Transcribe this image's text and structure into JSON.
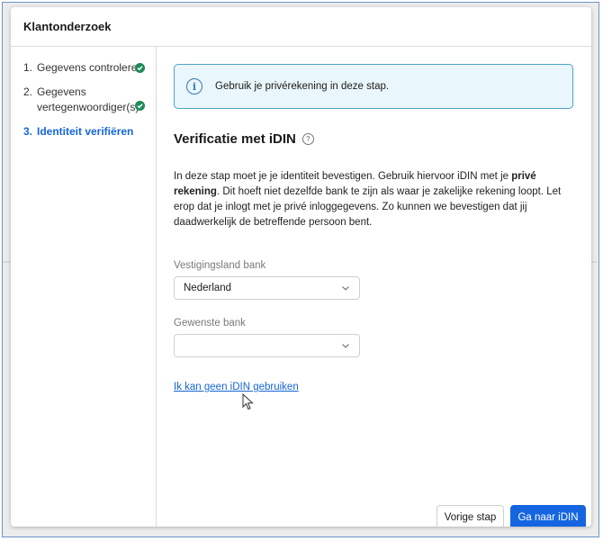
{
  "card": {
    "title": "Klantonderzoek"
  },
  "steps": [
    {
      "number": "1.",
      "label": "Gegevens controleren",
      "status": "completed"
    },
    {
      "number": "2.",
      "label": "Gegevens vertegenwoordiger(s)",
      "status": "completed"
    },
    {
      "number": "3.",
      "label": "Identiteit verifiëren",
      "status": "active"
    }
  ],
  "info_banner": {
    "icon": "info-icon",
    "text": "Gebruik je privérekening in deze stap."
  },
  "section": {
    "title": "Verificatie met iDIN",
    "help_icon": "question-circle-icon",
    "paragraph_before": "In deze stap moet je je identiteit bevestigen. Gebruik hiervoor iDIN met je ",
    "paragraph_bold": "privé rekening",
    "paragraph_after": ". Dit hoeft niet dezelfde bank te zijn als waar je zakelijke rekening loopt. Let erop dat je inlogt met je privé inloggegevens. Zo kunnen we bevestigen dat jij daadwerkelijk de betreffende persoon bent."
  },
  "fields": {
    "country": {
      "label": "Vestigingsland bank",
      "value": "Nederland"
    },
    "bank": {
      "label": "Gewenste bank",
      "value": ""
    }
  },
  "link": {
    "text": "Ik kan geen iDIN gebruiken"
  },
  "buttons": {
    "prev": "Vorige stap",
    "next": "Ga naar iDIN"
  },
  "colors": {
    "accent": "#1565e0",
    "success": "#1e8a5a",
    "info_border": "#4aa4c9",
    "info_bg": "#e9f6fb"
  }
}
